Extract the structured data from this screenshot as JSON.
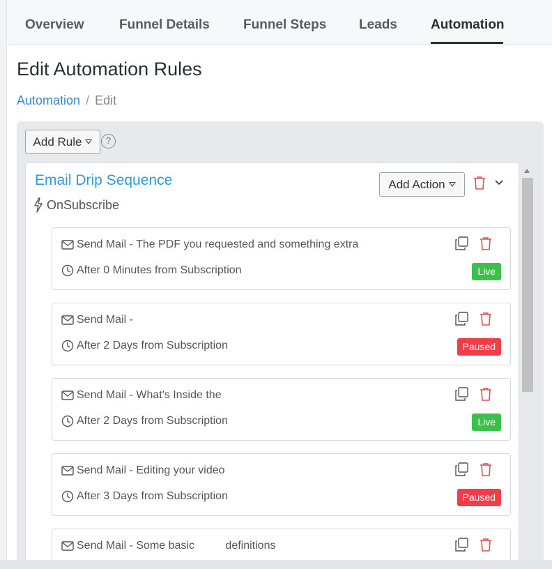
{
  "tabs": [
    {
      "label": "Overview"
    },
    {
      "label": "Funnel Details"
    },
    {
      "label": "Funnel Steps"
    },
    {
      "label": "Leads"
    },
    {
      "label": "Automation"
    }
  ],
  "page": {
    "title": "Edit Automation Rules",
    "breadcrumb": {
      "link": "Automation",
      "separator": "/",
      "current": "Edit"
    }
  },
  "toolbar": {
    "add_rule_label": "Add Rule",
    "help_label": "?"
  },
  "rule": {
    "title": "Email Drip Sequence",
    "trigger": "OnSubscribe",
    "add_action_label": "Add Action",
    "actions": [
      {
        "title": "Send Mail - The PDF you requested and something extra",
        "timing": "After 0 Minutes from Subscription",
        "status": "Live"
      },
      {
        "title": "Send Mail -",
        "timing": "After 2 Days from Subscription",
        "status": "Paused"
      },
      {
        "title": "Send Mail - What's Inside the",
        "timing": "After 2 Days from Subscription",
        "status": "Live"
      },
      {
        "title": "Send Mail - Editing your video",
        "timing": "After 3 Days from Subscription",
        "status": "Paused"
      },
      {
        "title": "Send Mail - Some basic          definitions",
        "timing": "",
        "status": ""
      }
    ]
  },
  "colors": {
    "link": "#3a87c8",
    "rule_title": "#2f9ae0",
    "live": "#3cbf4d",
    "paused": "#ef3e4a",
    "delete_icon": "#d9534f"
  },
  "icons": [
    "help-icon",
    "bolt-icon",
    "mail-icon",
    "clock-icon",
    "copy-icon",
    "trash-icon",
    "chevron-down-icon"
  ]
}
